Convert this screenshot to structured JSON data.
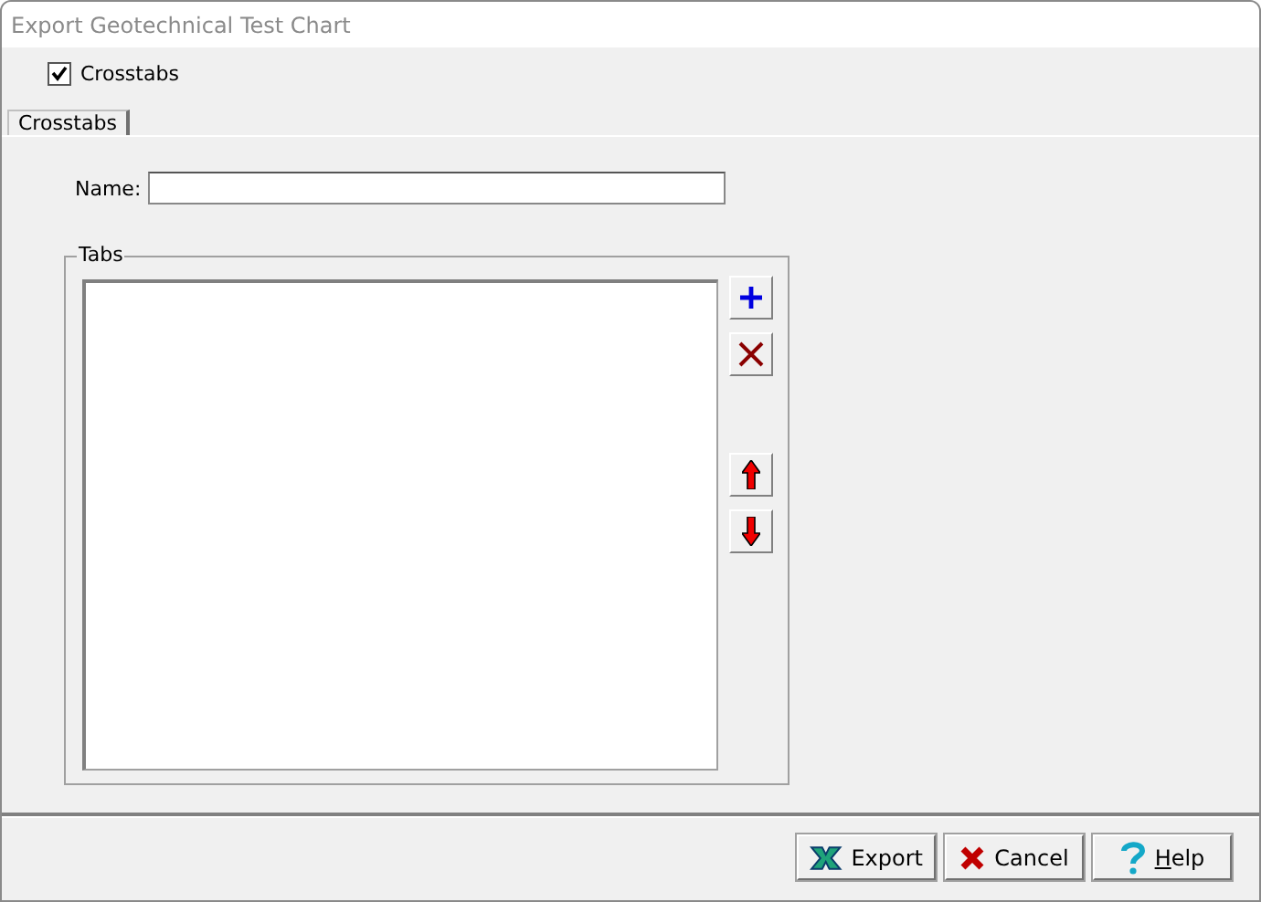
{
  "window": {
    "title": "Export Geotechnical Test Chart"
  },
  "crosstabs_option": {
    "label": "Crosstabs",
    "checked": true
  },
  "tabs": [
    {
      "label": "Crosstabs",
      "selected": true
    }
  ],
  "name_field": {
    "label": "Name:"
  },
  "tabs_group": {
    "title": "Tabs"
  },
  "buttons": [
    {
      "label": "Export",
      "kind": "export"
    },
    {
      "label": "Cancel",
      "kind": "cancel"
    },
    {
      "label": "Help",
      "kind": "help"
    }
  ]
}
